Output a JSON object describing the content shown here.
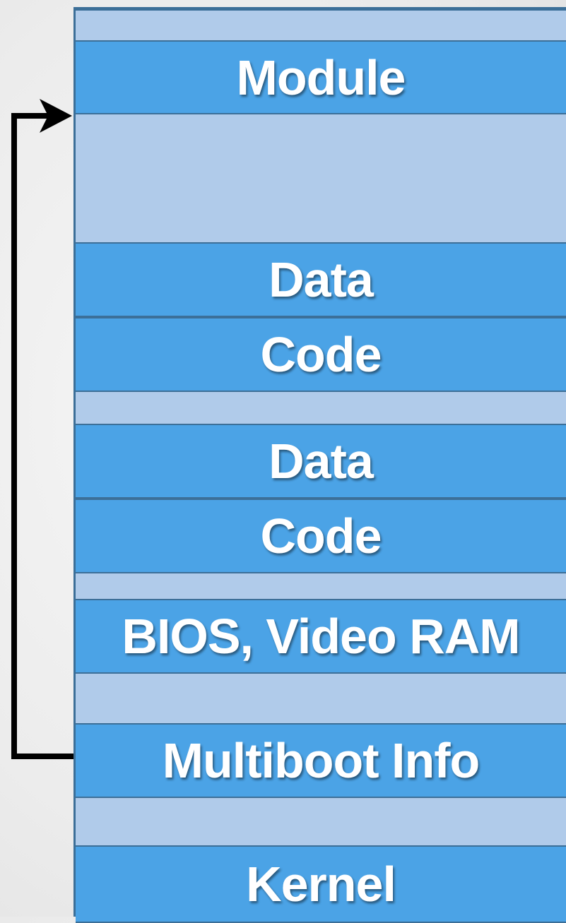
{
  "memory_map": {
    "blocks": [
      {
        "name": "free-region-top",
        "label": "",
        "kind": "free"
      },
      {
        "name": "module-block",
        "label": "Module",
        "kind": "filled"
      },
      {
        "name": "free-region-large",
        "label": "",
        "kind": "free"
      },
      {
        "name": "data-block-1",
        "label": "Data",
        "kind": "filled"
      },
      {
        "name": "code-block-1",
        "label": "Code",
        "kind": "filled"
      },
      {
        "name": "free-region-2",
        "label": "",
        "kind": "free"
      },
      {
        "name": "data-block-2",
        "label": "Data",
        "kind": "filled"
      },
      {
        "name": "code-block-2",
        "label": "Code",
        "kind": "filled"
      },
      {
        "name": "free-region-3",
        "label": "",
        "kind": "free"
      },
      {
        "name": "bios-video-ram-block",
        "label": "BIOS, Video RAM",
        "kind": "filled"
      },
      {
        "name": "free-region-4",
        "label": "",
        "kind": "free"
      },
      {
        "name": "multiboot-info-block",
        "label": "Multiboot Info",
        "kind": "filled"
      },
      {
        "name": "free-region-5",
        "label": "",
        "kind": "free"
      },
      {
        "name": "kernel-block",
        "label": "Kernel",
        "kind": "filled"
      }
    ]
  },
  "colors": {
    "filled": "#4ba3e6",
    "free": "#b0cbea",
    "border": "#3c6f98",
    "arrow": "#000000"
  }
}
